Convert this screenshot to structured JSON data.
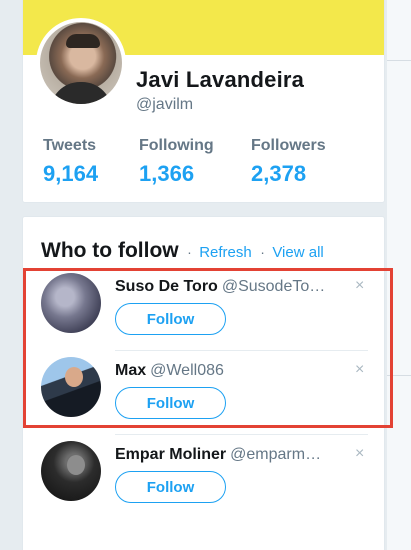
{
  "profile": {
    "name": "Javi Lavandeira",
    "handle": "@javilm",
    "stats": [
      {
        "label": "Tweets",
        "value": "9,164"
      },
      {
        "label": "Following",
        "value": "1,366"
      },
      {
        "label": "Followers",
        "value": "2,378"
      }
    ],
    "banner_color": "#f3e84b"
  },
  "who_to_follow": {
    "title": "Who to follow",
    "separator": "·",
    "refresh_label": "Refresh",
    "view_all_label": "View all",
    "suggestions": [
      {
        "name": "Suso De Toro",
        "handle": "@SusodeTo…",
        "follow_label": "Follow",
        "close_glyph": "×"
      },
      {
        "name": "Max",
        "handle": "@Well086",
        "follow_label": "Follow",
        "close_glyph": "×"
      },
      {
        "name": "Empar Moliner",
        "handle": "@emparm…",
        "follow_label": "Follow",
        "close_glyph": "×"
      }
    ]
  },
  "colors": {
    "accent": "#1da1f2",
    "highlight": "#e34234",
    "background": "#e6ecf0"
  },
  "icons": {
    "dismiss": "close-icon"
  }
}
